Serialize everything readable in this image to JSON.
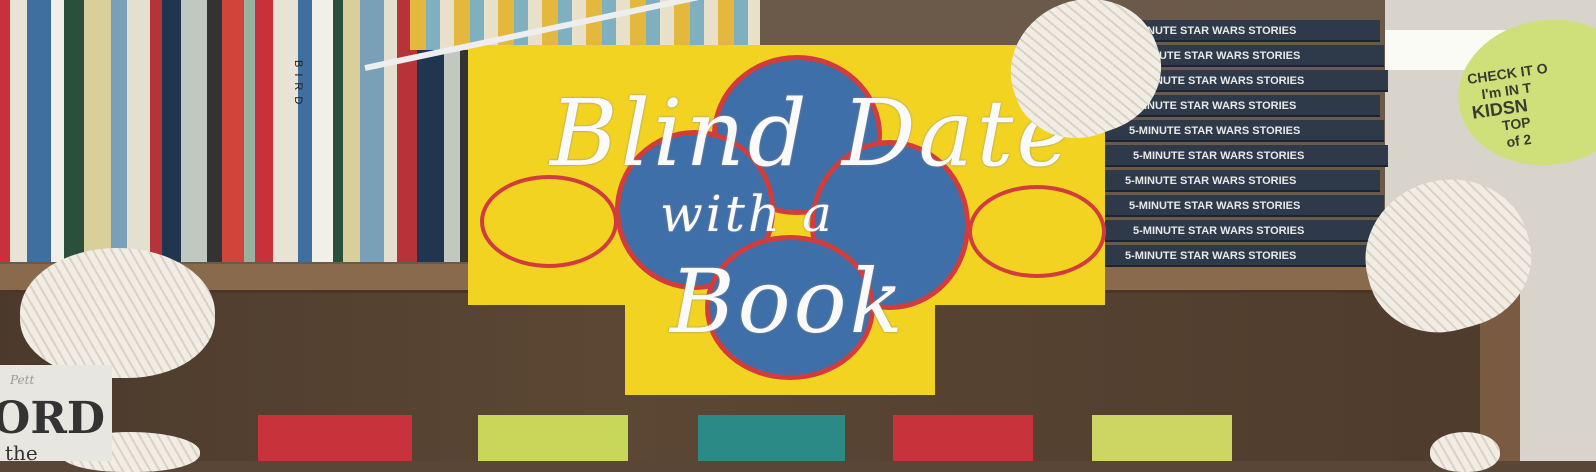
{
  "sign": {
    "line1": "Blind Date",
    "line2": "with a",
    "line3": "Book"
  },
  "book_stack": {
    "label": "5-MINUTE STAR WARS STORIES",
    "count": 10
  },
  "spine_text": "BIRD",
  "note": {
    "lines": [
      "CHECK IT O",
      "I'm IN T",
      "KIDSN",
      "TOP",
      "of 2"
    ]
  },
  "display_book": {
    "small": "Pett",
    "big": "ORD",
    "sub": "the"
  },
  "colors": {
    "sign_yellow": "#f3d322",
    "heart_blue": "#3f6fa8",
    "heart_red": "#d23c3c",
    "note_green": "#cfe07a"
  }
}
